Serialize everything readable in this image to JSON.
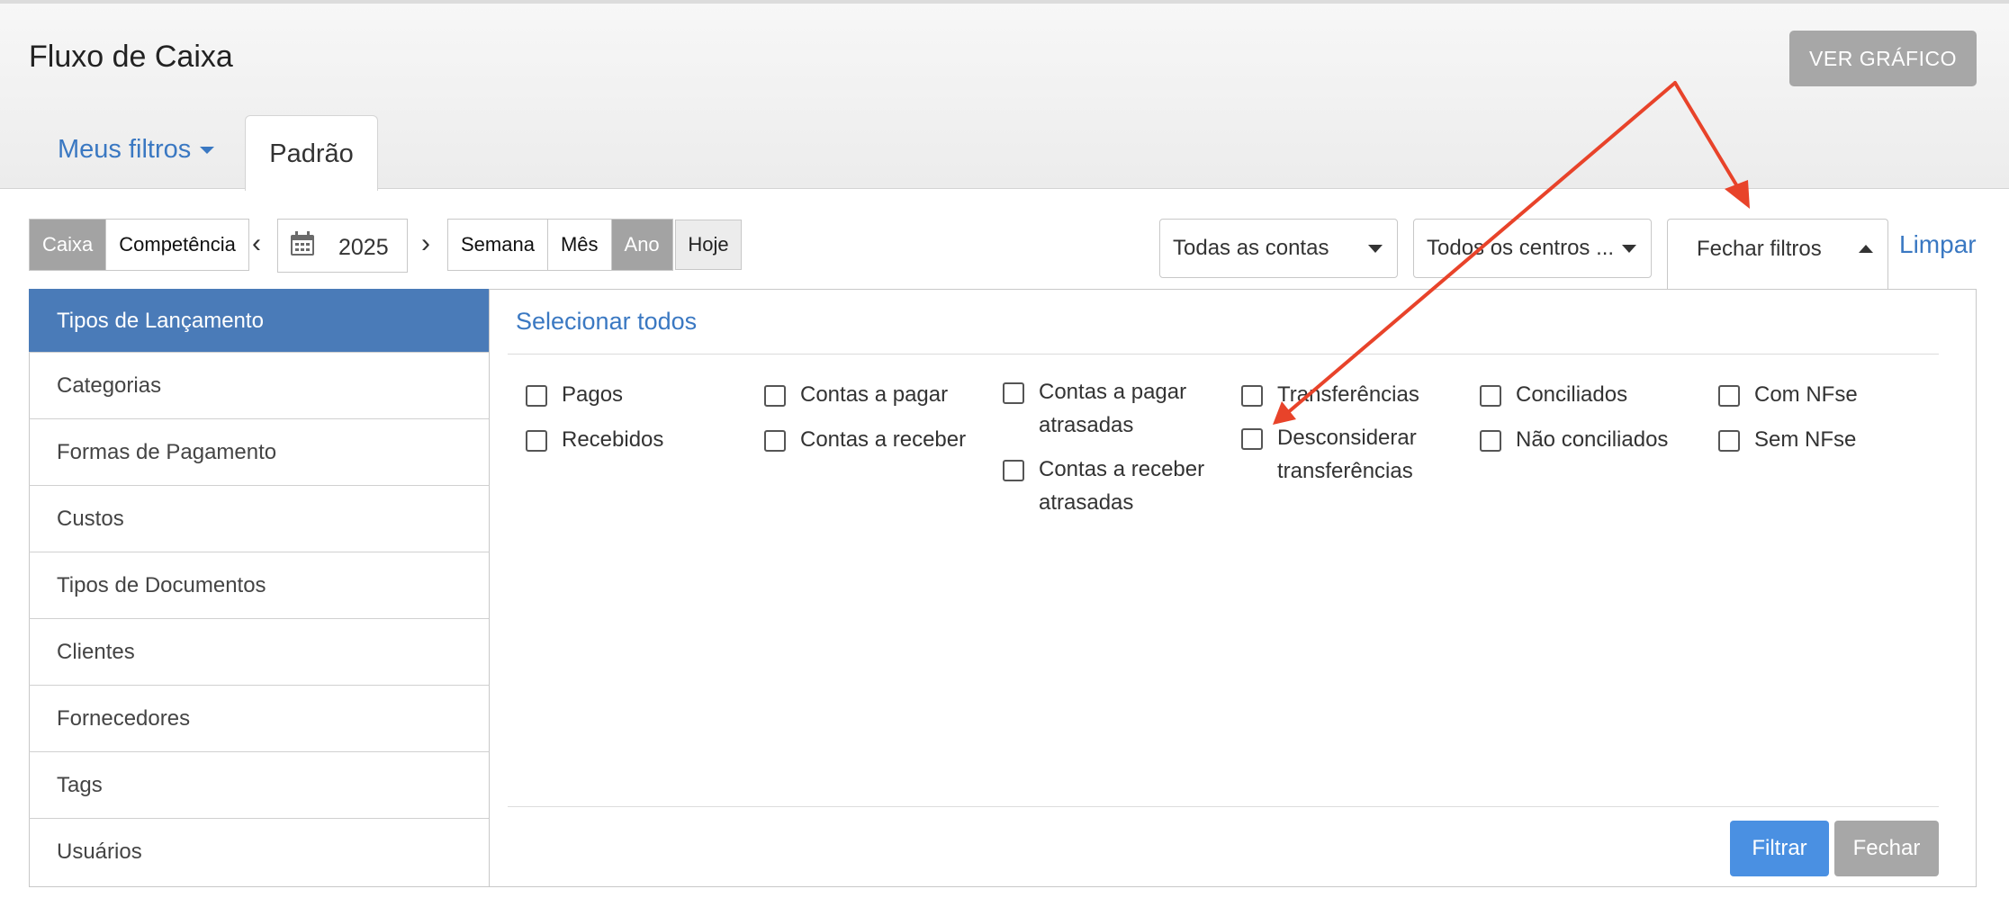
{
  "header": {
    "title": "Fluxo de Caixa",
    "chart_button": "VER GRÁFICO"
  },
  "tabs": {
    "my_filters": "Meus filtros",
    "default": "Padrão"
  },
  "basis": {
    "cash": "Caixa",
    "accrual": "Competência",
    "selected": "Caixa"
  },
  "date": {
    "year": "2025"
  },
  "period": {
    "week": "Semana",
    "month": "Mês",
    "year": "Ano",
    "selected": "Ano",
    "today": "Hoje"
  },
  "dropdowns": {
    "accounts": "Todas as contas",
    "centers": "Todos os centros ..."
  },
  "filters_toggle": "Fechar filtros",
  "clear": "Limpar",
  "sidebar": {
    "items": [
      {
        "label": "Tipos de Lançamento",
        "active": true
      },
      {
        "label": "Categorias"
      },
      {
        "label": "Formas de Pagamento"
      },
      {
        "label": "Custos"
      },
      {
        "label": "Tipos de Documentos"
      },
      {
        "label": "Clientes"
      },
      {
        "label": "Fornecedores"
      },
      {
        "label": "Tags"
      },
      {
        "label": "Usuários"
      }
    ]
  },
  "select_all": "Selecionar todos",
  "options": {
    "paid": "Pagos",
    "received": "Recebidos",
    "payables": "Contas a pagar",
    "receivables": "Contas a receber",
    "overdue_payables_1": "Contas a pagar",
    "overdue_payables_2": "atrasadas",
    "overdue_receivables_1": "Contas a receber",
    "overdue_receivables_2": "atrasadas",
    "transfers": "Transferências",
    "ignore_transfers_1": "Desconsiderar",
    "ignore_transfers_2": "transferências",
    "reconciled": "Conciliados",
    "not_reconciled": "Não conciliados",
    "with_nfse": "Com NFse",
    "without_nfse": "Sem NFse"
  },
  "actions": {
    "filter": "Filtrar",
    "close": "Fechar"
  },
  "colors": {
    "accent": "#3a78c2",
    "active_sidebar": "#4a7bb8",
    "primary_button": "#4a90e2",
    "annotation": "#e8432a"
  }
}
